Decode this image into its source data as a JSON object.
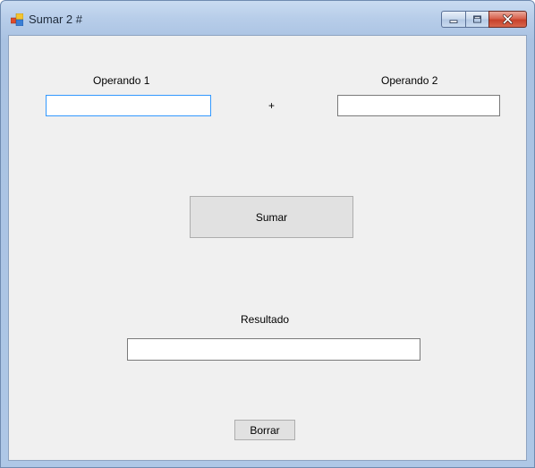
{
  "window": {
    "title": "Sumar 2 #",
    "icons": {
      "app": "app-form-icon",
      "minimize": "minimize-icon",
      "maximize": "maximize-icon",
      "close": "close-icon"
    }
  },
  "form": {
    "operand1_label": "Operando 1",
    "operand1_value": "",
    "operator": "+",
    "operand2_label": "Operando 2",
    "operand2_value": "",
    "sum_button": "Sumar",
    "result_label": "Resultado",
    "result_value": "",
    "clear_button": "Borrar"
  },
  "colors": {
    "client_background": "#f0f0f0",
    "focus_border": "#3399ff",
    "close_button": "#c7412a"
  }
}
